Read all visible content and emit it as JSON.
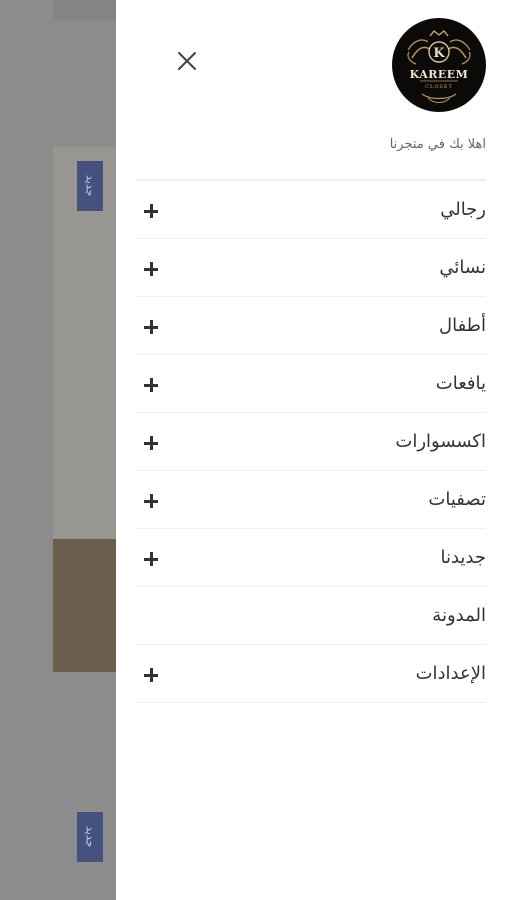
{
  "background": {
    "badge_text": "جديد",
    "badge_color": "#45517f"
  },
  "drawer": {
    "close_icon": "close-icon",
    "logo": {
      "initial": "K",
      "name": "KAREEM",
      "sub": "CLOSET"
    },
    "welcome_text": "اهلا بك في متجرنا",
    "menu": [
      {
        "label": "رجالي",
        "expandable": true
      },
      {
        "label": "نسائي",
        "expandable": true
      },
      {
        "label": "أطفال",
        "expandable": true
      },
      {
        "label": "يافعات",
        "expandable": true
      },
      {
        "label": "اكسسوارات",
        "expandable": true
      },
      {
        "label": "تصفيات",
        "expandable": true
      },
      {
        "label": "جديدنا",
        "expandable": true
      },
      {
        "label": "المدونة",
        "expandable": false
      },
      {
        "label": "الإعدادات",
        "expandable": true
      }
    ]
  }
}
